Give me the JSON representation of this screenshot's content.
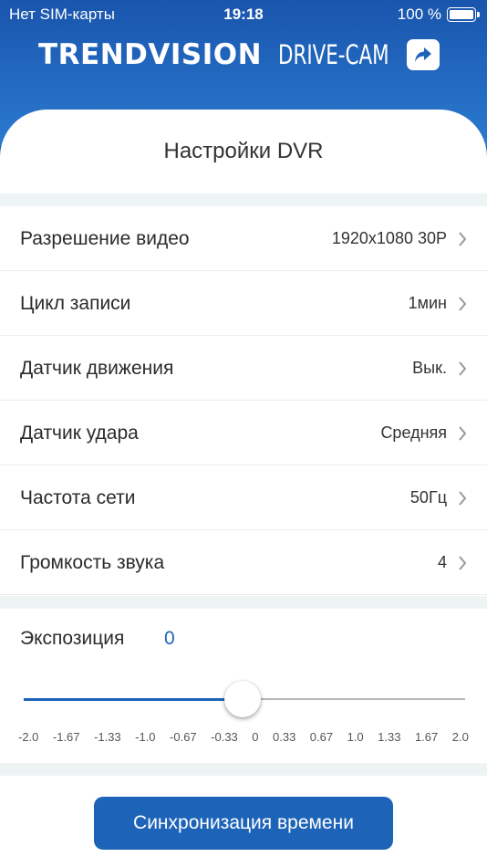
{
  "status_bar": {
    "carrier": "Нет SIM-карты",
    "time": "19:18",
    "battery": "100 %"
  },
  "brand": {
    "logo_main": "TRENDVISION",
    "logo_sub": "DRIVE-CAM",
    "share_icon": "share-icon"
  },
  "page": {
    "title": "Настройки DVR"
  },
  "settings": [
    {
      "label": "Разрешение видео",
      "value": "1920x1080 30P"
    },
    {
      "label": "Цикл записи",
      "value": "1мин"
    },
    {
      "label": "Датчик движения",
      "value": "Вык."
    },
    {
      "label": "Датчик удара",
      "value": "Средняя"
    },
    {
      "label": "Частота сети",
      "value": "50Гц"
    },
    {
      "label": "Громкость звука",
      "value": "4"
    }
  ],
  "exposure": {
    "label": "Экспозиция",
    "value": "0",
    "ticks": [
      "-2.0",
      "-1.67",
      "-1.33",
      "-1.0",
      "-0.67",
      "-0.33",
      "0",
      "0.33",
      "0.67",
      "1.0",
      "1.33",
      "1.67",
      "2.0"
    ],
    "accent": "#1d63b8"
  },
  "sync_button": {
    "label": "Синхронизация времени"
  }
}
